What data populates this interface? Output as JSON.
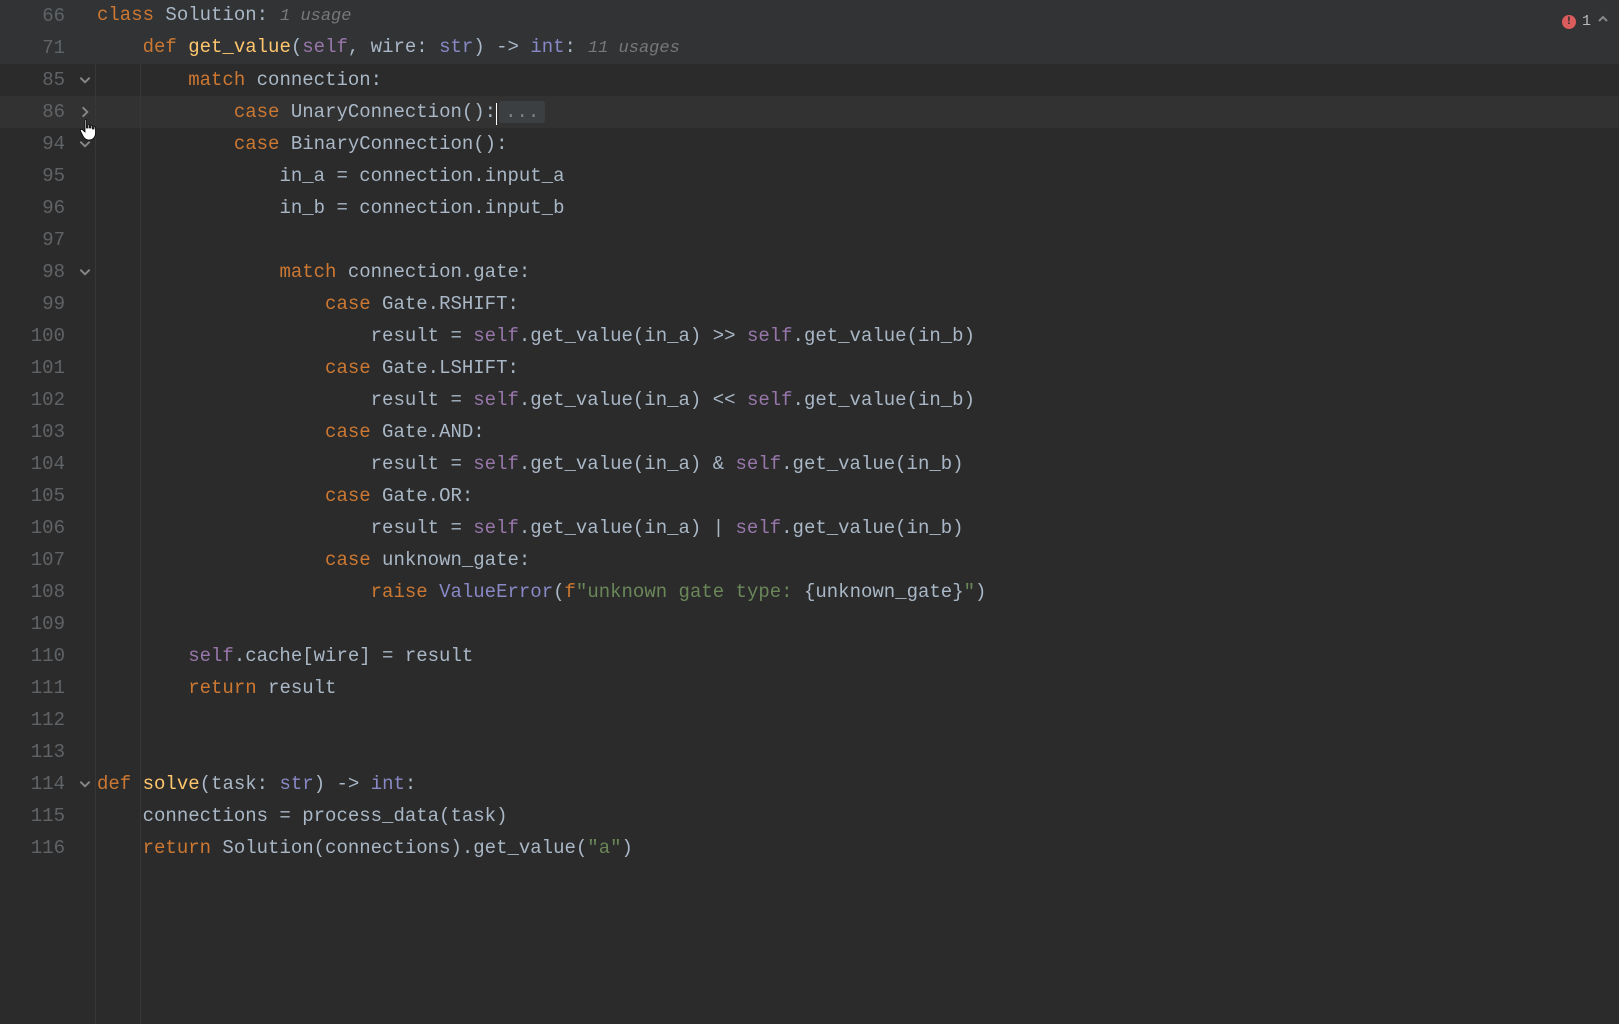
{
  "problems": {
    "error_count": "1"
  },
  "fold_placeholder": "...",
  "lines": [
    {
      "n": "66",
      "sticky": true,
      "fold": "",
      "indent": 0,
      "tokens": [
        [
          "k",
          "class"
        ],
        [
          "p",
          " "
        ],
        [
          "cls",
          "Solution"
        ],
        [
          "p",
          ":"
        ]
      ],
      "inlay": "1 usage"
    },
    {
      "n": "71",
      "sticky": true,
      "fold": "",
      "indent": 1,
      "tokens": [
        [
          "k",
          "def"
        ],
        [
          "p",
          " "
        ],
        [
          "fn",
          "get_value"
        ],
        [
          "p",
          "("
        ],
        [
          "self",
          "self"
        ],
        [
          "p",
          ", wire: "
        ],
        [
          "bi",
          "str"
        ],
        [
          "p",
          ") -> "
        ],
        [
          "bi",
          "int"
        ],
        [
          "p",
          ":"
        ]
      ],
      "inlay": "11 usages"
    },
    {
      "n": "85",
      "fold": "down",
      "indent": 2,
      "tokens": [
        [
          "k",
          "match"
        ],
        [
          "p",
          " connection:"
        ]
      ]
    },
    {
      "n": "86",
      "fold": "right",
      "indent": 3,
      "cursor": true,
      "folded": true,
      "tokens": [
        [
          "k",
          "case"
        ],
        [
          "p",
          " UnaryConnection():"
        ]
      ]
    },
    {
      "n": "94",
      "fold": "down",
      "indent": 3,
      "tokens": [
        [
          "k",
          "case"
        ],
        [
          "p",
          " BinaryConnection():"
        ]
      ]
    },
    {
      "n": "95",
      "indent": 4,
      "tokens": [
        [
          "p",
          "in_a = connection.input_a"
        ]
      ]
    },
    {
      "n": "96",
      "indent": 4,
      "tokens": [
        [
          "p",
          "in_b = connection.input_b"
        ]
      ]
    },
    {
      "n": "97",
      "indent": 0,
      "tokens": [
        [
          "p",
          ""
        ]
      ]
    },
    {
      "n": "98",
      "fold": "down",
      "indent": 4,
      "tokens": [
        [
          "k",
          "match"
        ],
        [
          "p",
          " connection.gate:"
        ]
      ]
    },
    {
      "n": "99",
      "indent": 5,
      "tokens": [
        [
          "k",
          "case"
        ],
        [
          "p",
          " Gate.RSHIFT:"
        ]
      ]
    },
    {
      "n": "100",
      "indent": 6,
      "tokens": [
        [
          "p",
          "result = "
        ],
        [
          "self",
          "self"
        ],
        [
          "p",
          ".get_value(in_a) >> "
        ],
        [
          "self",
          "self"
        ],
        [
          "p",
          ".get_value(in_b)"
        ]
      ]
    },
    {
      "n": "101",
      "indent": 5,
      "tokens": [
        [
          "k",
          "case"
        ],
        [
          "p",
          " Gate.LSHIFT:"
        ]
      ]
    },
    {
      "n": "102",
      "indent": 6,
      "tokens": [
        [
          "p",
          "result = "
        ],
        [
          "self",
          "self"
        ],
        [
          "p",
          ".get_value(in_a) << "
        ],
        [
          "self",
          "self"
        ],
        [
          "p",
          ".get_value(in_b)"
        ]
      ]
    },
    {
      "n": "103",
      "indent": 5,
      "tokens": [
        [
          "k",
          "case"
        ],
        [
          "p",
          " Gate.AND:"
        ]
      ]
    },
    {
      "n": "104",
      "indent": 6,
      "tokens": [
        [
          "p",
          "result = "
        ],
        [
          "self",
          "self"
        ],
        [
          "p",
          ".get_value(in_a) & "
        ],
        [
          "self",
          "self"
        ],
        [
          "p",
          ".get_value(in_b)"
        ]
      ]
    },
    {
      "n": "105",
      "indent": 5,
      "tokens": [
        [
          "k",
          "case"
        ],
        [
          "p",
          " Gate.OR:"
        ]
      ]
    },
    {
      "n": "106",
      "indent": 6,
      "tokens": [
        [
          "p",
          "result = "
        ],
        [
          "self",
          "self"
        ],
        [
          "p",
          ".get_value(in_a) | "
        ],
        [
          "self",
          "self"
        ],
        [
          "p",
          ".get_value(in_b)"
        ]
      ]
    },
    {
      "n": "107",
      "indent": 5,
      "tokens": [
        [
          "k",
          "case"
        ],
        [
          "p",
          " unknown_gate:"
        ]
      ]
    },
    {
      "n": "108",
      "indent": 6,
      "tokens": [
        [
          "k",
          "raise"
        ],
        [
          "p",
          " "
        ],
        [
          "bi",
          "ValueError"
        ],
        [
          "p",
          "("
        ],
        [
          "fstrp",
          "f"
        ],
        [
          "str",
          "\"unknown gate type: "
        ],
        [
          "p",
          "{"
        ],
        [
          "p",
          "unknown_gate"
        ],
        [
          "p",
          "}"
        ],
        [
          "str",
          "\""
        ],
        [
          "p",
          ")"
        ]
      ]
    },
    {
      "n": "109",
      "indent": 0,
      "tokens": [
        [
          "p",
          ""
        ]
      ]
    },
    {
      "n": "110",
      "indent": 2,
      "tokens": [
        [
          "self",
          "self"
        ],
        [
          "p",
          ".cache[wire] = result"
        ]
      ]
    },
    {
      "n": "111",
      "indent": 2,
      "tokens": [
        [
          "k",
          "return"
        ],
        [
          "p",
          " result"
        ]
      ]
    },
    {
      "n": "112",
      "indent": 0,
      "tokens": [
        [
          "p",
          ""
        ]
      ]
    },
    {
      "n": "113",
      "indent": 0,
      "tokens": [
        [
          "p",
          ""
        ]
      ]
    },
    {
      "n": "114",
      "fold": "down",
      "indent": 0,
      "tokens": [
        [
          "k",
          "def"
        ],
        [
          "p",
          " "
        ],
        [
          "fn",
          "solve"
        ],
        [
          "p",
          "(task: "
        ],
        [
          "bi",
          "str"
        ],
        [
          "p",
          ") -> "
        ],
        [
          "bi",
          "int"
        ],
        [
          "p",
          ":"
        ]
      ]
    },
    {
      "n": "115",
      "indent": 1,
      "tokens": [
        [
          "p",
          "connections = process_data(task)"
        ]
      ]
    },
    {
      "n": "116",
      "indent": 1,
      "tokens": [
        [
          "k",
          "return"
        ],
        [
          "p",
          " Solution(connections).get_value("
        ],
        [
          "str",
          "\"a\""
        ],
        [
          "p",
          ")"
        ]
      ]
    }
  ]
}
